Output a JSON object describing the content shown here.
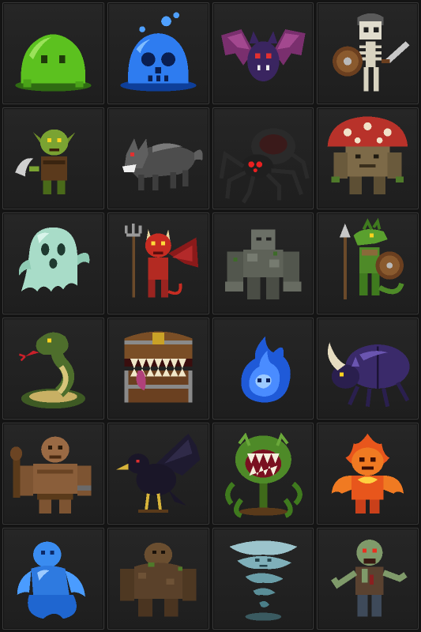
{
  "palette": {
    "background": "#141414",
    "tile": "#232323",
    "tile_border": "#3a3a3a"
  },
  "grid": {
    "columns": 4,
    "rows": 6
  },
  "monsters": [
    {
      "name": "green-slime",
      "icon": "green-slime-icon"
    },
    {
      "name": "blue-skull-slime",
      "icon": "blue-skull-slime-icon"
    },
    {
      "name": "purple-bat",
      "icon": "purple-bat-icon"
    },
    {
      "name": "skeleton-warrior",
      "icon": "skeleton-warrior-icon"
    },
    {
      "name": "goblin",
      "icon": "goblin-icon"
    },
    {
      "name": "grey-wolf",
      "icon": "grey-wolf-icon"
    },
    {
      "name": "giant-spider",
      "icon": "giant-spider-icon"
    },
    {
      "name": "mushroom-brute",
      "icon": "mushroom-brute-icon"
    },
    {
      "name": "ghost",
      "icon": "ghost-icon"
    },
    {
      "name": "red-imp",
      "icon": "red-imp-icon"
    },
    {
      "name": "stone-golem",
      "icon": "stone-golem-icon"
    },
    {
      "name": "lizardfolk",
      "icon": "lizardfolk-icon"
    },
    {
      "name": "cobra",
      "icon": "cobra-icon"
    },
    {
      "name": "mimic-chest",
      "icon": "mimic-chest-icon"
    },
    {
      "name": "blue-wisp",
      "icon": "blue-wisp-icon"
    },
    {
      "name": "horned-beetle",
      "icon": "horned-beetle-icon"
    },
    {
      "name": "ogre",
      "icon": "ogre-icon"
    },
    {
      "name": "raven",
      "icon": "raven-icon"
    },
    {
      "name": "carnivorous-plant",
      "icon": "carnivorous-plant-icon"
    },
    {
      "name": "fire-elemental",
      "icon": "fire-elemental-icon"
    },
    {
      "name": "water-elemental",
      "icon": "water-elemental-icon"
    },
    {
      "name": "earth-golem",
      "icon": "earth-golem-icon"
    },
    {
      "name": "tornado-spirit",
      "icon": "tornado-spirit-icon"
    },
    {
      "name": "zombie",
      "icon": "zombie-icon"
    }
  ]
}
